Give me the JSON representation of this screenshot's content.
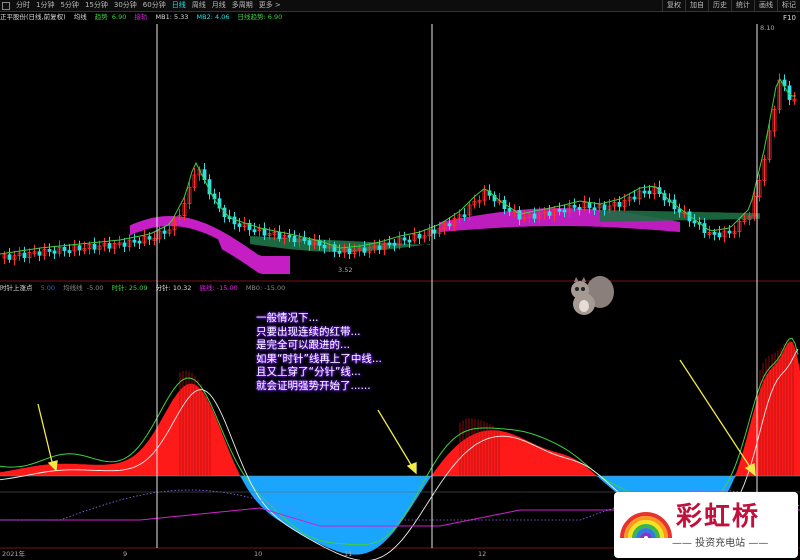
{
  "toolbar": {
    "tabs": [
      "分时",
      "1分钟",
      "5分钟",
      "15分钟",
      "30分钟",
      "60分钟",
      "日线",
      "周线",
      "月线",
      "多周期",
      "更多 >"
    ],
    "active_tab": "日线",
    "right_buttons": [
      "复权",
      "加自",
      "历史",
      "统计",
      "画线",
      "标记"
    ]
  },
  "price_info": {
    "stock_name": "正平股份(日线,前复权)",
    "ma_label": "均线",
    "trend_label": "趋势",
    "trend_value": "6.90",
    "extra_label": "接轨",
    "mb1": "MB1: 5.33",
    "mb2": "MB2: 4.06",
    "day_trend": "日线趋势: 6.90"
  },
  "price_axis": {
    "high_label": "8.10",
    "low_label": "3.52",
    "right_labels": [
      "F10"
    ]
  },
  "indicator_info": {
    "name": "时针上涨点",
    "v1": "5.00",
    "v2_label": "均线线",
    "v2": "-5.00",
    "shizhen": "时针: 25.09",
    "fenzhen": "分针: 10.32",
    "zhongxian": "底线: -15.00",
    "mb0": "MB0: -15.00"
  },
  "annotation": [
    "一般情况下...",
    "只要出现连续的红带...",
    "是完全可以跟进的...",
    "如果“时针”线再上了中线...",
    "且又上穿了“分针”线...",
    "就会证明强势开始了......"
  ],
  "time_axis": [
    "2021年",
    "9",
    "10",
    "11",
    "12"
  ],
  "logo": {
    "brand": "彩虹桥",
    "subtitle": "—— 投资充电站 ——"
  },
  "colors": {
    "red": "#ff1a1a",
    "blue": "#1aa5ff",
    "magenta": "#e020e0",
    "green_ma": "#2e8b57",
    "cyan": "#19e5e5"
  }
}
